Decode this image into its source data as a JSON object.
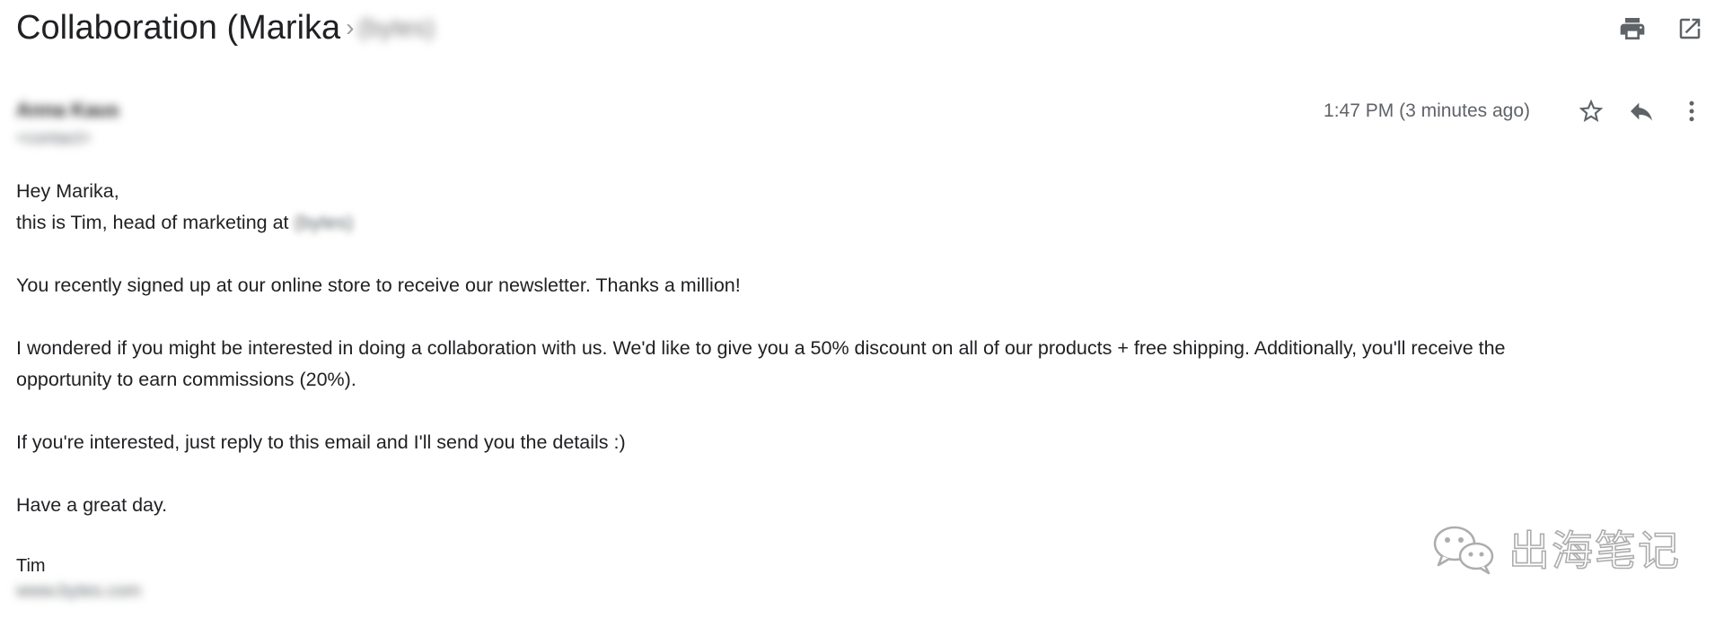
{
  "email": {
    "subject": "Collaboration (Marika",
    "label_chip": "(bytes)",
    "sender_name": "Anna Kaus",
    "sender_email": "<contact>",
    "timestamp": "1:47 PM (3 minutes ago)",
    "greeting": "Hey Marika,",
    "intro_prefix": "this is Tim, head of marketing at",
    "intro_company": "(bytes)",
    "para1": "You recently signed up at our online store to receive our newsletter. Thanks a million!",
    "para2_line1": "I wondered if you might be interested in doing a collaboration with us. We'd like to give you a 50% discount on all of our products + free shipping. Additionally, you'll receive the",
    "para2_line2": "opportunity to earn commissions (20%).",
    "para3": "If you're interested, just reply to this email and I'll send you the details :)",
    "closing": "Have a great day.",
    "signature_name": "Tim",
    "signature_company": "www.bytes.com"
  },
  "icons": {
    "print": "print-icon",
    "open_new_window": "open-in-new-window-icon",
    "star": "star-icon",
    "reply": "reply-icon",
    "more": "more-vertical-icon"
  },
  "watermark": {
    "text": "出海笔记",
    "logo": "wechat-logo"
  },
  "colors": {
    "text": "#202124",
    "secondary": "#5f6368",
    "icon": "#5f6368"
  }
}
